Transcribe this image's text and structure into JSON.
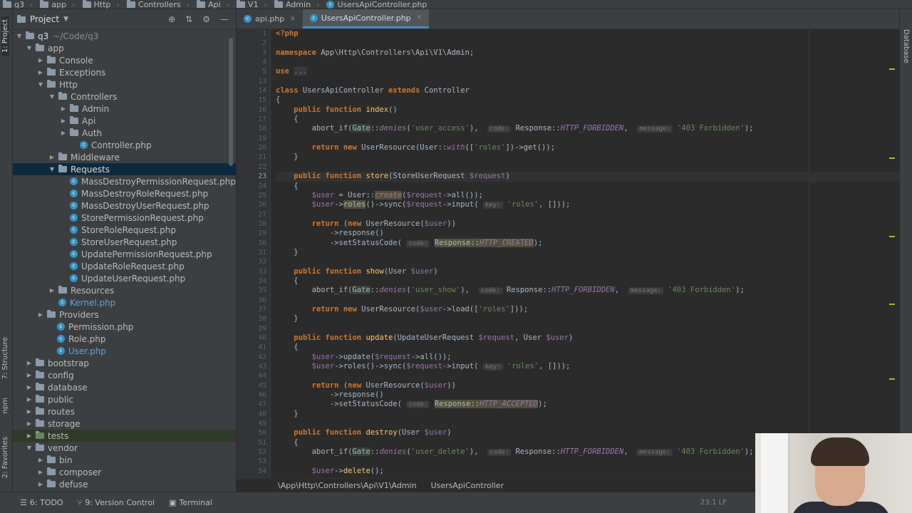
{
  "breadcrumb": [
    "q3",
    "app",
    "Http",
    "Controllers",
    "Api",
    "V1",
    "Admin",
    "UsersApiController.php"
  ],
  "left_strip": {
    "project_tab": "1: Project",
    "structure_tab": "7: Structure",
    "npm_tab": "npm",
    "favorites_tab": "2: Favorites"
  },
  "right_strip": {
    "database_tab": "Database"
  },
  "project_panel": {
    "title": "Project",
    "root": {
      "name": "q3",
      "path": "~/Code/q3"
    },
    "tree": [
      {
        "name": "app"
      },
      {
        "name": "Console"
      },
      {
        "name": "Exceptions"
      },
      {
        "name": "Http"
      },
      {
        "name": "Controllers"
      },
      {
        "name": "Admin"
      },
      {
        "name": "Api"
      },
      {
        "name": "Auth"
      },
      {
        "name": "Controller.php"
      },
      {
        "name": "Middleware"
      },
      {
        "name": "Requests"
      },
      {
        "name": "MassDestroyPermissionRequest.php"
      },
      {
        "name": "MassDestroyRoleRequest.php"
      },
      {
        "name": "MassDestroyUserRequest.php"
      },
      {
        "name": "StorePermissionRequest.php"
      },
      {
        "name": "StoreRoleRequest.php"
      },
      {
        "name": "StoreUserRequest.php"
      },
      {
        "name": "UpdatePermissionRequest.php"
      },
      {
        "name": "UpdateRoleRequest.php"
      },
      {
        "name": "UpdateUserRequest.php"
      },
      {
        "name": "Resources"
      },
      {
        "name": "Kernel.php"
      },
      {
        "name": "Providers"
      },
      {
        "name": "Permission.php"
      },
      {
        "name": "Role.php"
      },
      {
        "name": "User.php"
      },
      {
        "name": "bootstrap"
      },
      {
        "name": "config"
      },
      {
        "name": "database"
      },
      {
        "name": "public"
      },
      {
        "name": "routes"
      },
      {
        "name": "storage"
      },
      {
        "name": "tests"
      },
      {
        "name": "vendor"
      },
      {
        "name": "bin"
      },
      {
        "name": "composer"
      },
      {
        "name": "defuse"
      }
    ]
  },
  "tabs": [
    {
      "label": "api.php"
    },
    {
      "label": "UsersApiController.php"
    }
  ],
  "editor": {
    "line_numbers": [
      "1",
      "2",
      "3",
      "4",
      "5",
      "13",
      "14",
      "15",
      "16",
      "17",
      "18",
      "19",
      "20",
      "21",
      "22",
      "23",
      "24",
      "25",
      "26",
      "27",
      "28",
      "29",
      "30",
      "31",
      "32",
      "33",
      "34",
      "35",
      "36",
      "37",
      "38",
      "39",
      "40",
      "41",
      "42",
      "43",
      "44",
      "45",
      "46",
      "47",
      "48",
      "49",
      "50",
      "51",
      "52",
      "53",
      "54"
    ],
    "hints": {
      "code": "code:",
      "message": "message:",
      "key": "key:"
    },
    "strings": {
      "user_access": "'user_access'",
      "forbidden": "'403 Forbidden'",
      "roles": "'roles'",
      "user_show": "'user_show'",
      "user_delete": "'user_delete'"
    }
  },
  "editor_breadcrumb": {
    "namespace": "\\App\\Http\\Controllers\\Api\\V1\\Admin",
    "class": "UsersApiController"
  },
  "status_bar": {
    "todo": "6: TODO",
    "vcs": "9: Version Control",
    "terminal": "Terminal",
    "position": "23:1  LF"
  },
  "colors": {
    "keyword": "#cc7832",
    "function": "#ffc66d",
    "string": "#6a8759",
    "variable": "#9876aa",
    "default": "#a9b7c6",
    "selection": "#0d293e"
  }
}
